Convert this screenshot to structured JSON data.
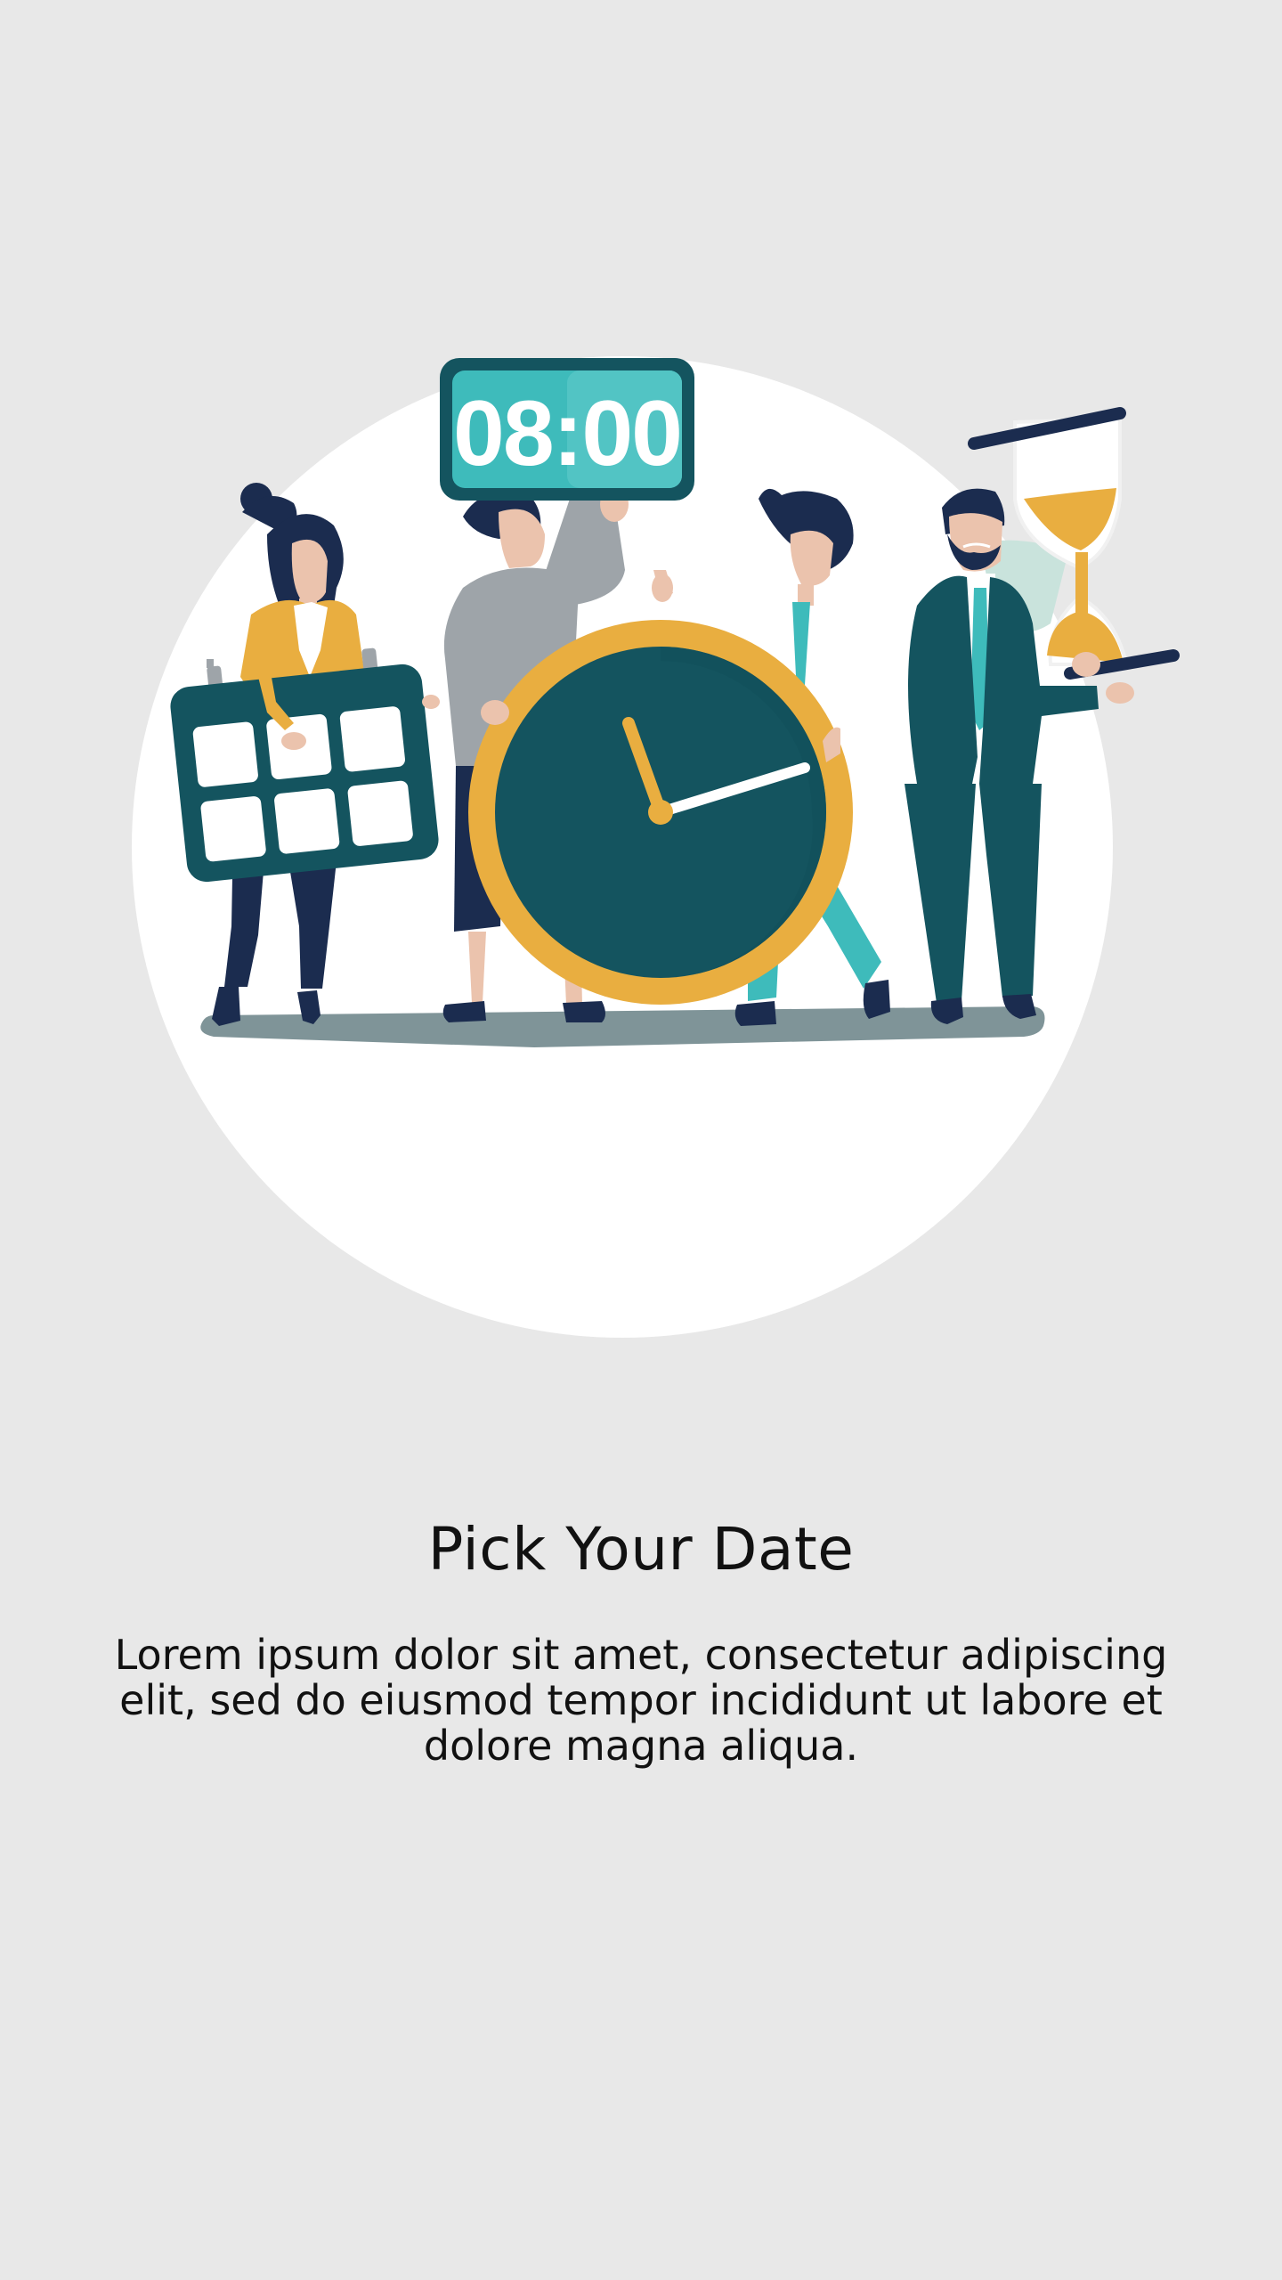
{
  "onboarding": {
    "title": "Pick Your Date",
    "description": "Lorem ipsum dolor sit amet, consectetur adipiscing elit, sed do eiusmod tempor incididunt ut labore et dolore magna aliqua.",
    "digital_clock_text": "08:00"
  },
  "colors": {
    "background": "#e8e8e8",
    "circle": "#ffffff",
    "dark_teal": "#14545f",
    "teal": "#3ebbbb",
    "mustard": "#e9ae40",
    "navy": "#1b2c4f",
    "grey": "#9ea4a9",
    "skin": "#ebc3ad",
    "floor": "#7f9498"
  }
}
